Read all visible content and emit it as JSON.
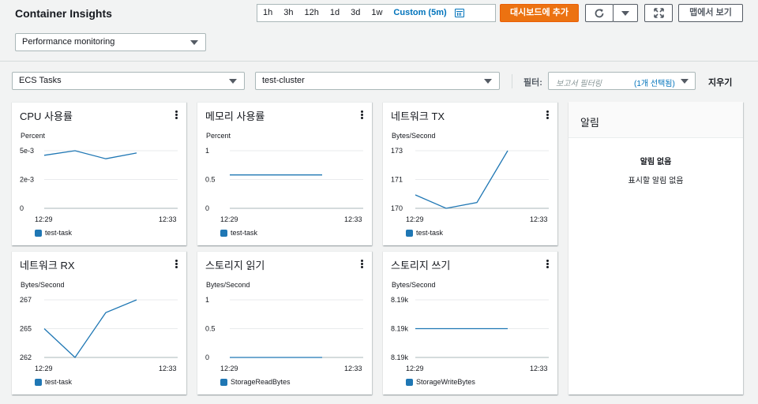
{
  "header": {
    "title": "Container Insights",
    "time_ranges": [
      "1h",
      "3h",
      "12h",
      "1d",
      "3d",
      "1w"
    ],
    "custom_range": "Custom (5m)",
    "add_dashboard_label": "대시보드에 추가",
    "view_map_label": "맵에서 보기",
    "view_select": "Performance monitoring"
  },
  "filters": {
    "resource_type": "ECS Tasks",
    "cluster": "test-cluster",
    "filter_label": "필터:",
    "filter_placeholder": "보고서 필터링",
    "filter_count": "(1개 선택됨)",
    "clear_label": "지우기"
  },
  "colors": {
    "series": "#1f77b4",
    "accent": "#ec7211",
    "link": "#0073bb"
  },
  "cards": [
    {
      "title": "CPU 사용률",
      "unit": "Percent",
      "legend": "test-task"
    },
    {
      "title": "메모리 사용률",
      "unit": "Percent",
      "legend": "test-task"
    },
    {
      "title": "네트워크 TX",
      "unit": "Bytes/Second",
      "legend": "test-task"
    },
    {
      "title": "네트워크 RX",
      "unit": "Bytes/Second",
      "legend": "test-task"
    },
    {
      "title": "스토리지 읽기",
      "unit": "Bytes/Second",
      "legend": "StorageReadBytes"
    },
    {
      "title": "스토리지 쓰기",
      "unit": "Bytes/Second",
      "legend": "StorageWriteBytes"
    }
  ],
  "alerts": {
    "title": "알림",
    "empty_title": "알림 없음",
    "empty_desc": "표시할 알림 없음"
  },
  "chart_data": [
    {
      "type": "line",
      "x_start": "12:29",
      "x_end": "12:33",
      "yticks": [
        "5e-3",
        "2e-3",
        "0"
      ],
      "ylim": [
        0,
        0.005
      ],
      "series": [
        {
          "name": "test-task",
          "values": [
            0.0046,
            0.005,
            0.0043,
            0.0048
          ]
        }
      ]
    },
    {
      "type": "line",
      "x_start": "12:29",
      "x_end": "12:33",
      "yticks": [
        "1",
        "0.5",
        "0"
      ],
      "ylim": [
        0,
        1
      ],
      "series": [
        {
          "name": "test-task",
          "values": [
            0.58,
            0.58,
            0.58,
            0.58
          ]
        }
      ]
    },
    {
      "type": "line",
      "x_start": "12:29",
      "x_end": "12:33",
      "yticks": [
        "173",
        "171",
        "170"
      ],
      "ylim": [
        170,
        173
      ],
      "series": [
        {
          "name": "test-task",
          "values": [
            170.7,
            170,
            170.3,
            173
          ]
        }
      ]
    },
    {
      "type": "line",
      "x_start": "12:29",
      "x_end": "12:33",
      "yticks": [
        "267",
        "265",
        "262"
      ],
      "ylim": [
        262,
        267
      ],
      "series": [
        {
          "name": "test-task",
          "values": [
            264.5,
            262,
            265.9,
            267
          ]
        }
      ]
    },
    {
      "type": "line",
      "x_start": "12:29",
      "x_end": "12:33",
      "yticks": [
        "1",
        "0.5",
        "0"
      ],
      "ylim": [
        0,
        1
      ],
      "series": [
        {
          "name": "StorageReadBytes",
          "values": [
            0,
            0,
            0,
            0
          ]
        }
      ]
    },
    {
      "type": "line",
      "x_start": "12:29",
      "x_end": "12:33",
      "yticks": [
        "8.19k",
        "8.19k",
        "8.19k"
      ],
      "ylim": [
        0,
        1
      ],
      "series": [
        {
          "name": "StorageWriteBytes",
          "values": [
            0.5,
            0.5,
            0.5,
            0.5
          ]
        }
      ]
    }
  ]
}
